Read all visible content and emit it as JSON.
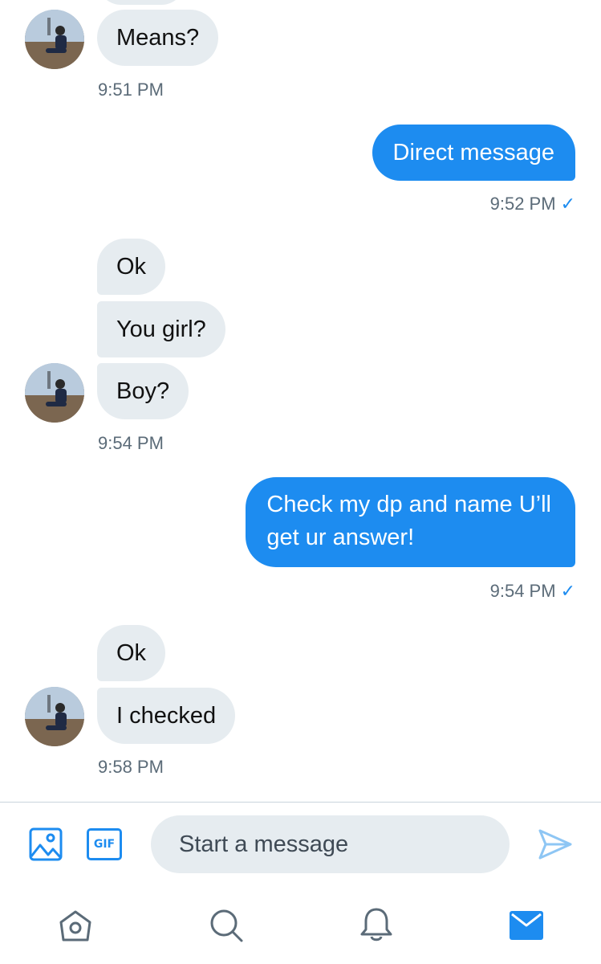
{
  "conversation": {
    "messages": [
      {
        "text": "Means?"
      },
      {
        "text": "Direct message"
      },
      {
        "text": "Ok"
      },
      {
        "text": "You girl?"
      },
      {
        "text": "Boy?"
      },
      {
        "line1": "Check my dp and name U’ll",
        "line2": "get ur answer!"
      },
      {
        "text": "Ok"
      },
      {
        "text": "I checked"
      }
    ],
    "timestamps": {
      "t1": "9:51 PM",
      "t2": "9:52 PM",
      "t3": "9:54 PM",
      "t4": "9:54 PM",
      "t5": "9:58 PM"
    },
    "read_check": "✓"
  },
  "composer": {
    "placeholder": "Start a message",
    "gif_label": "GIF"
  },
  "icons": {
    "image": "image-icon",
    "gif": "gif-icon",
    "send": "send-icon",
    "home": "home-icon",
    "search": "search-icon",
    "notifications": "bell-icon",
    "messages": "mail-icon"
  },
  "colors": {
    "accent": "#1d8cf0",
    "incoming_bubble": "#e6ecf0",
    "timestamp": "#5b6b78"
  }
}
